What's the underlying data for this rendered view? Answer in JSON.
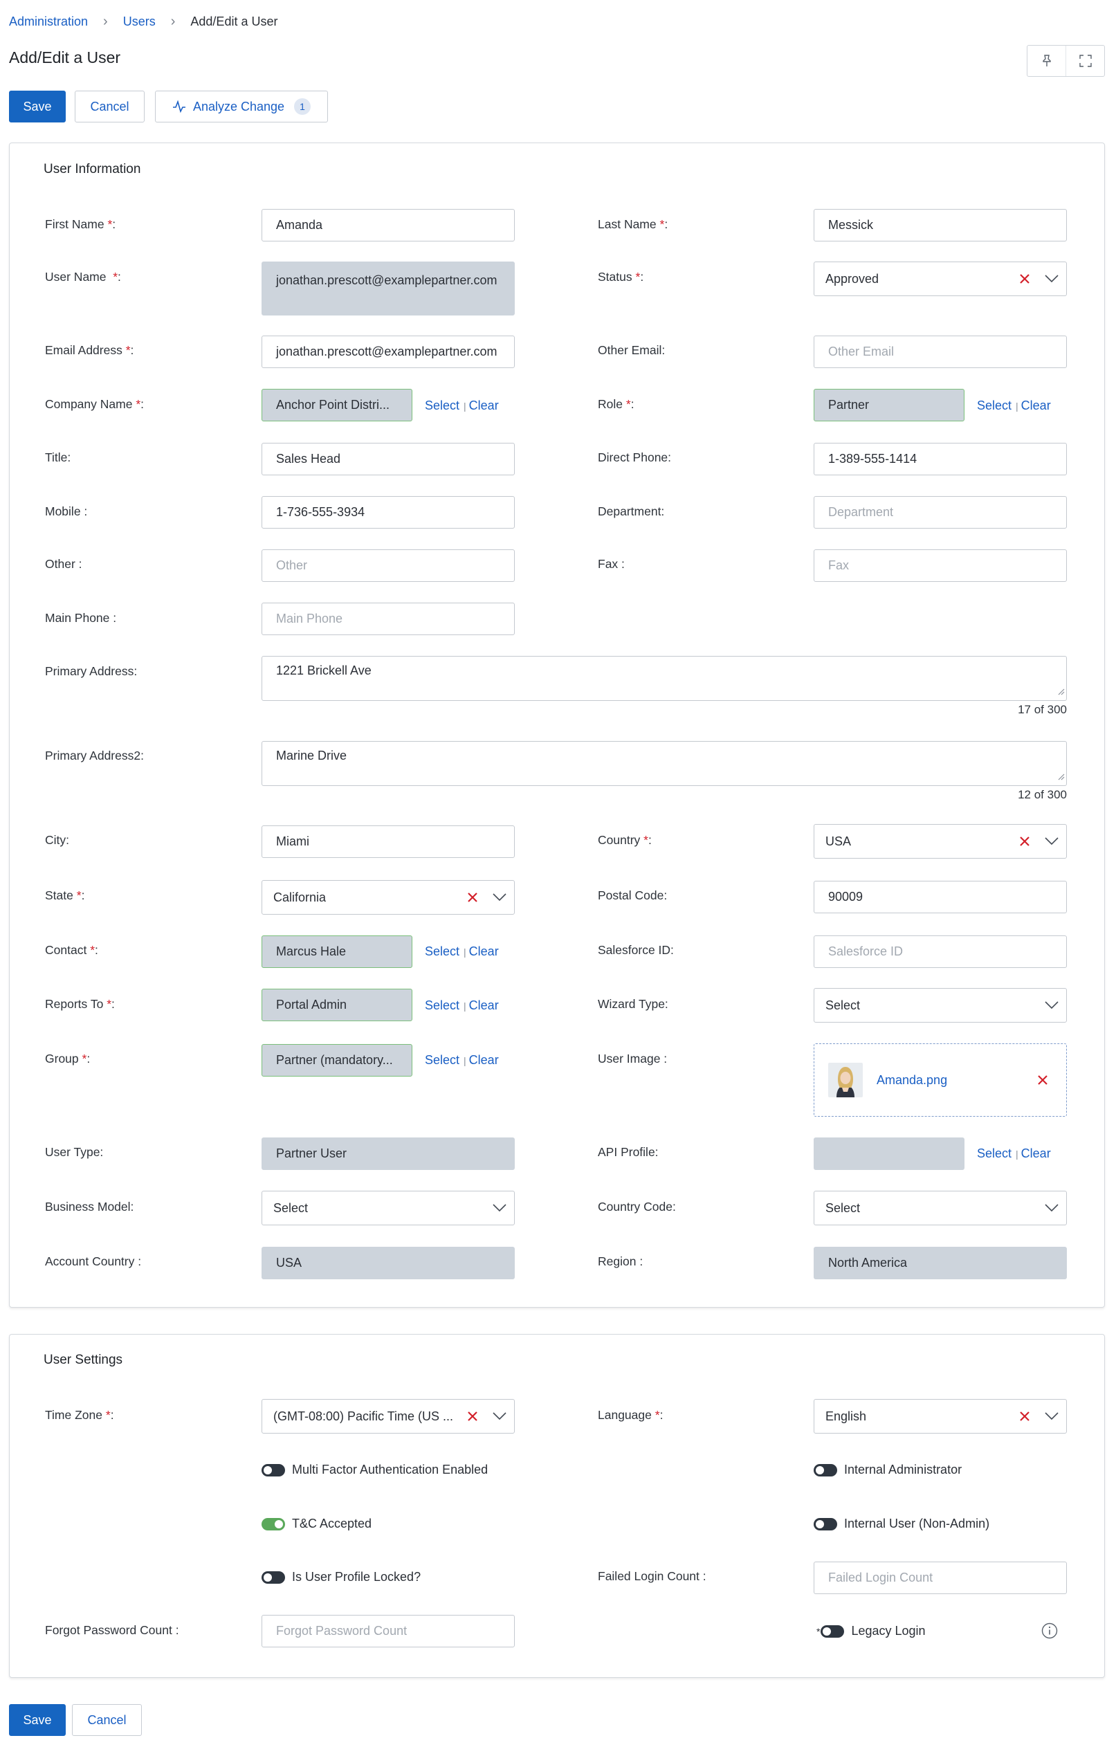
{
  "breadcrumb": [
    "Administration",
    "Users",
    "Add/Edit a User"
  ],
  "page_title": "Add/Edit a User",
  "toolbar": {
    "save": "Save",
    "cancel": "Cancel",
    "analyze": "Analyze Change",
    "analyze_count": "1"
  },
  "user_info": {
    "title": "User Information",
    "first_name": {
      "label": "First Name",
      "value": "Amanda"
    },
    "last_name": {
      "label": "Last Name",
      "value": "Messick"
    },
    "user_name": {
      "label": "User Name",
      "value": "jonathan.prescott@examplepartner.com"
    },
    "status": {
      "label": "Status",
      "value": "Approved"
    },
    "email": {
      "label": "Email Address",
      "value": "jonathan.prescott@examplepartner.com"
    },
    "other_email": {
      "label": "Other Email:",
      "placeholder": "Other Email"
    },
    "company": {
      "label": "Company Name",
      "value": "Anchor Point Distri..."
    },
    "role": {
      "label": "Role",
      "value": "Partner"
    },
    "title_field": {
      "label": "Title:",
      "value": "Sales Head"
    },
    "direct_phone": {
      "label": "Direct Phone:",
      "value": "1-389-555-1414"
    },
    "mobile": {
      "label": "Mobile :",
      "value": "1-736-555-3934"
    },
    "department": {
      "label": "Department:",
      "placeholder": "Department"
    },
    "other": {
      "label": "Other :",
      "placeholder": "Other"
    },
    "fax": {
      "label": "Fax :",
      "placeholder": "Fax"
    },
    "main_phone": {
      "label": "Main Phone :",
      "placeholder": "Main Phone"
    },
    "primary_address": {
      "label": "Primary Address:",
      "value": "1221 Brickell Ave",
      "counter": "17 of 300"
    },
    "primary_address2": {
      "label": "Primary Address2:",
      "value": "Marine Drive",
      "counter": "12 of 300"
    },
    "city": {
      "label": "City:",
      "value": "Miami"
    },
    "country": {
      "label": "Country",
      "value": "USA"
    },
    "state": {
      "label": "State",
      "value": "California"
    },
    "postal_code": {
      "label": "Postal Code:",
      "value": "90009"
    },
    "contact": {
      "label": "Contact",
      "value": "Marcus Hale"
    },
    "salesforce_id": {
      "label": "Salesforce ID:",
      "placeholder": "Salesforce ID"
    },
    "reports_to": {
      "label": "Reports To",
      "value": "Portal Admin"
    },
    "wizard_type": {
      "label": "Wizard Type:",
      "value": "Select"
    },
    "group": {
      "label": "Group",
      "value": "Partner (mandatory..."
    },
    "user_image": {
      "label": "User Image :",
      "file": "Amanda.png"
    },
    "user_type": {
      "label": "User Type:",
      "value": "Partner User"
    },
    "api_profile": {
      "label": "API Profile:",
      "value": ""
    },
    "business_model": {
      "label": "Business Model:",
      "value": "Select"
    },
    "country_code": {
      "label": "Country Code:",
      "value": "Select"
    },
    "account_country": {
      "label": "Account Country :",
      "value": "USA"
    },
    "region": {
      "label": "Region :",
      "value": "North America"
    }
  },
  "select_link": "Select",
  "clear_link": "Clear",
  "required_mark": "*",
  "user_settings": {
    "title": "User Settings",
    "time_zone": {
      "label": "Time Zone",
      "value": "(GMT-08:00) Pacific Time (US ..."
    },
    "language": {
      "label": "Language",
      "value": "English"
    },
    "mfa": "Multi Factor Authentication Enabled",
    "internal_admin": "Internal Administrator",
    "tc_accepted": "T&C Accepted",
    "internal_user": "Internal User (Non-Admin)",
    "profile_locked": "Is User Profile Locked?",
    "failed_login": {
      "label": "Failed Login Count :",
      "placeholder": "Failed Login Count"
    },
    "forgot_password": {
      "label": "Forgot Password Count :",
      "placeholder": "Forgot Password Count"
    },
    "legacy_login": "Legacy Login"
  },
  "footer": {
    "save": "Save",
    "cancel": "Cancel"
  }
}
